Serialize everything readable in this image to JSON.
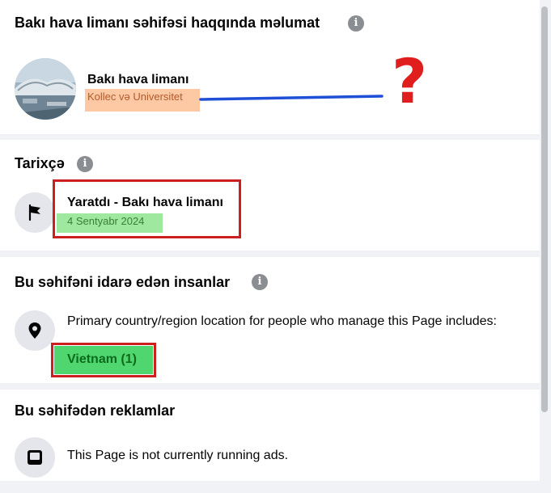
{
  "about": {
    "title": "Bakı hava limanı səhifəsi haqqında məlumat",
    "info_glyph": "i",
    "page_name": "Bakı hava limanı",
    "category": "Kollec və Universitet",
    "annotation": "?"
  },
  "history": {
    "title": "Tarixçə",
    "info_glyph": "i",
    "created_label": "Yaratdı - Bakı hava limanı",
    "created_date": "4 Sentyabr 2024"
  },
  "managers": {
    "title": "Bu səhifəni idarə edən insanlar",
    "info_glyph": "i",
    "description": "Primary country/region location for people who manage this Page includes:",
    "country": "Vietnam (1)"
  },
  "ads": {
    "title": "Bu səhifədən reklamlar",
    "status": "This Page is not currently running ads."
  },
  "colors": {
    "highlight_orange": "#fdc9a5",
    "highlight_green_light": "#9fe89f",
    "highlight_green": "#4fd66f",
    "annotation_red": "#cc1f1f",
    "annotation_blue": "#1f4fd6"
  }
}
